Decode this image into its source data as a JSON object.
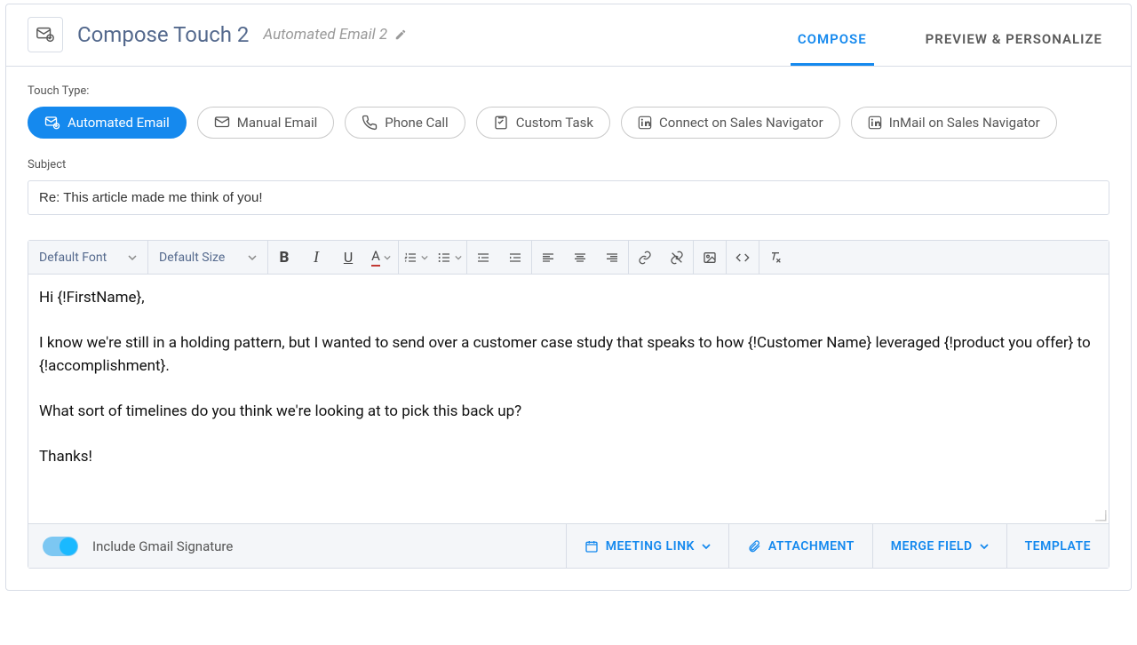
{
  "header": {
    "title": "Compose Touch 2",
    "subtitle": "Automated Email 2"
  },
  "tabs": {
    "compose": "COMPOSE",
    "preview": "PREVIEW & PERSONALIZE"
  },
  "touch_type": {
    "label": "Touch Type:",
    "options": {
      "auto_email": "Automated Email",
      "manual_email": "Manual Email",
      "phone_call": "Phone Call",
      "custom_task": "Custom Task",
      "connect_sn": "Connect on Sales Navigator",
      "inmail_sn": "InMail on Sales Navigator"
    }
  },
  "subject": {
    "label": "Subject",
    "value": "Re: This article made me think of you!"
  },
  "toolbar": {
    "font": "Default Font",
    "size": "Default Size"
  },
  "body_lines": {
    "l1": "Hi {!FirstName},",
    "l2": "",
    "l3": "I know we're still in a holding pattern, but I wanted to send over a customer case study that speaks to how {!Customer Name} leveraged {!product you offer} to {!accomplishment}.",
    "l4": "",
    "l5": "What sort of timelines do you think we're looking at to pick this back up?",
    "l6": "",
    "l7": "Thanks!"
  },
  "footer": {
    "signature": "Include Gmail Signature",
    "meeting": "MEETING LINK",
    "attachment": "ATTACHMENT",
    "merge": "MERGE FIELD",
    "template": "TEMPLATE"
  }
}
